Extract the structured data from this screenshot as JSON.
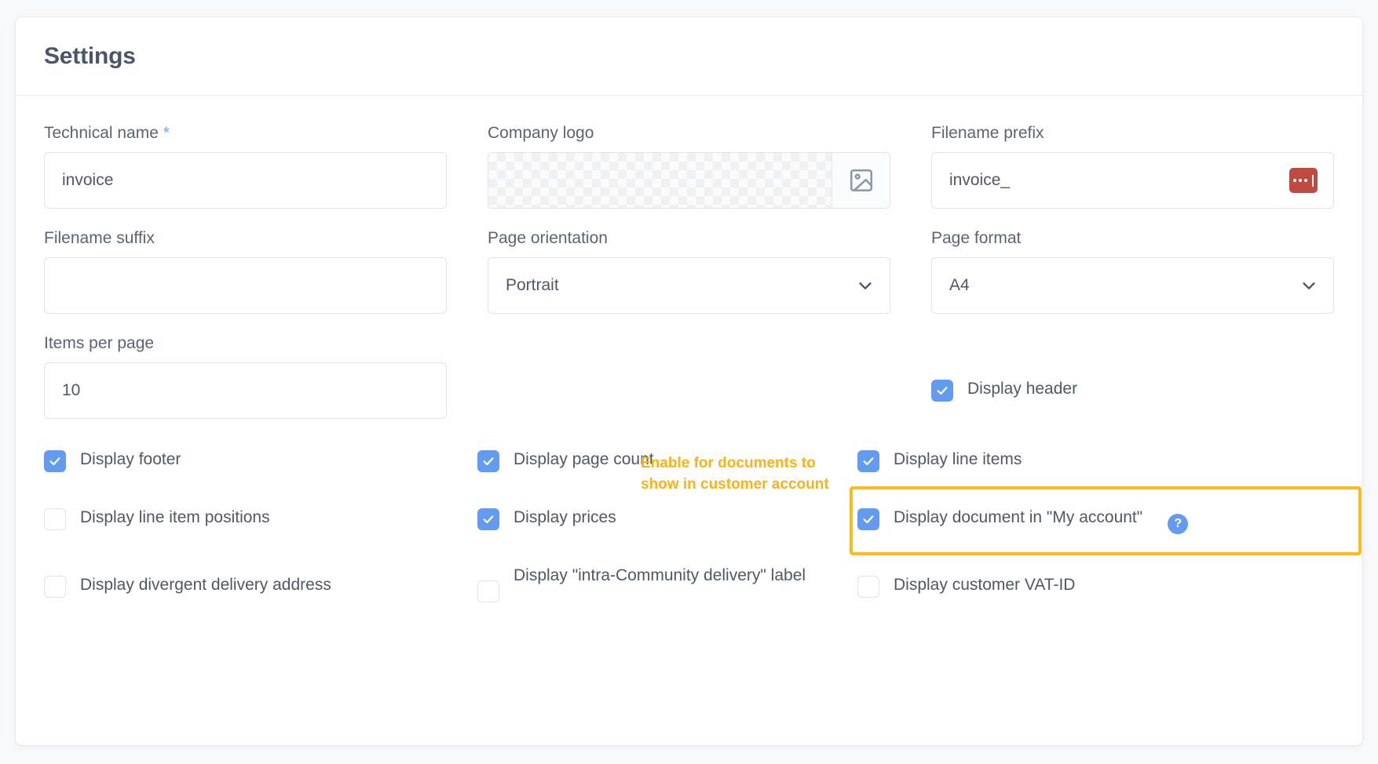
{
  "card": {
    "title": "Settings"
  },
  "fields": {
    "technical_name": {
      "label": "Technical name",
      "required_marker": "*",
      "value": "invoice"
    },
    "company_logo": {
      "label": "Company logo",
      "upload_icon": "image-icon"
    },
    "filename_prefix": {
      "label": "Filename prefix",
      "value": "invoice_",
      "badge_icon": "ellipsis-cursor-badge",
      "badge_color": "#bf4a3f"
    },
    "filename_suffix": {
      "label": "Filename suffix",
      "value": ""
    },
    "page_orientation": {
      "label": "Page orientation",
      "value": "Portrait",
      "chevron_icon": "chevron-down-icon"
    },
    "page_format": {
      "label": "Page format",
      "value": "A4",
      "chevron_icon": "chevron-down-icon"
    },
    "items_per_page": {
      "label": "Items per page",
      "value": "10"
    }
  },
  "checkboxes": {
    "display_header": {
      "label": "Display header",
      "checked": true
    },
    "display_footer": {
      "label": "Display footer",
      "checked": true
    },
    "display_line_item_positions": {
      "label": "Display line item positions",
      "checked": false
    },
    "display_divergent_delivery_address": {
      "label": "Display divergent delivery address",
      "checked": false
    },
    "display_page_count": {
      "label": "Display page count",
      "checked": true
    },
    "display_prices": {
      "label": "Display prices",
      "checked": true
    },
    "display_intra_community": {
      "label": "Display \"intra-Community delivery\" label",
      "checked": false
    },
    "display_line_items": {
      "label": "Display line items",
      "checked": true
    },
    "display_document_my_account": {
      "label": "Display document in \"My account\"",
      "checked": true,
      "help_icon": "question-mark-icon"
    },
    "display_customer_vat_id": {
      "label": "Display customer VAT-ID",
      "checked": false
    }
  },
  "annotation": {
    "text": "Enable for documents to show in customer account",
    "color": "#f9b319",
    "highlight_color": "#f9bc1c"
  },
  "colors": {
    "accent_blue": "#629bf0",
    "page_background": "#f8f9fb",
    "card_background": "#ffffff",
    "text": "#4e5868"
  }
}
